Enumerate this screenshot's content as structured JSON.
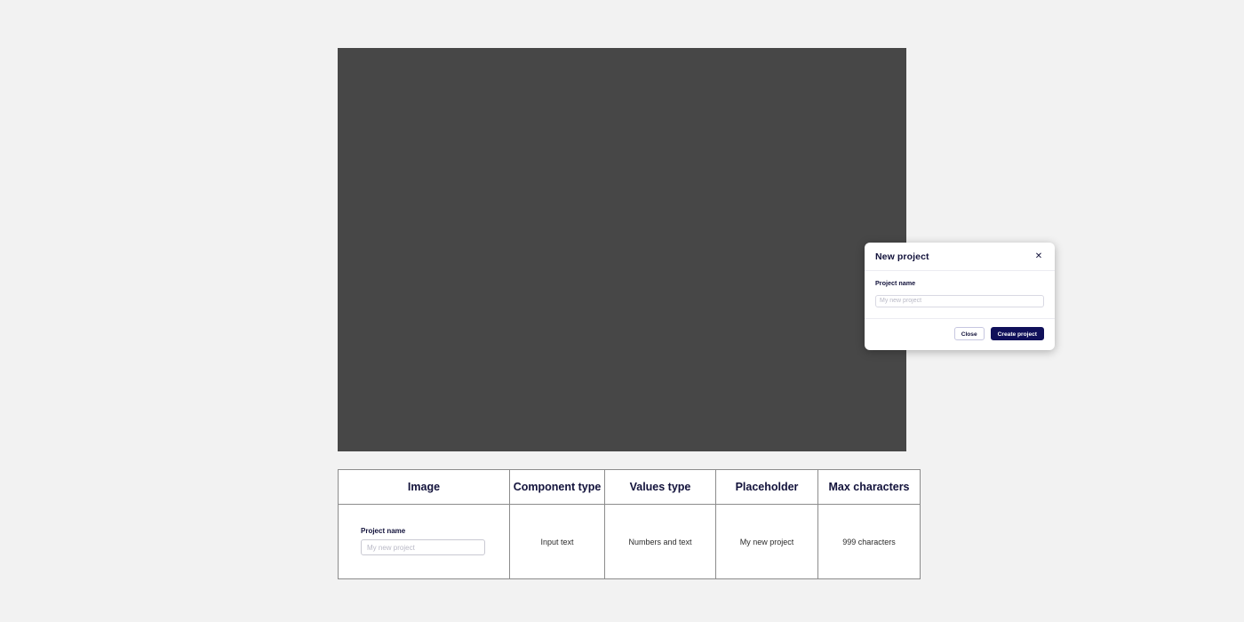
{
  "page": {
    "background_color": "#f2f2f2"
  },
  "preview": {
    "backdrop_color": "#474747"
  },
  "modal": {
    "title": "New project",
    "close_icon": "close-icon",
    "close_glyph": "✕",
    "field": {
      "label": "Project name",
      "value": "",
      "placeholder": "My new project"
    },
    "buttons": {
      "secondary_label": "Close",
      "primary_label": "Create project",
      "primary_color": "#10105a",
      "secondary_border_color": "#c7c7e0"
    }
  },
  "spec_table": {
    "headers": [
      "Image",
      "Component type",
      "Values type",
      "Placeholder",
      "Max characters"
    ],
    "rows": [
      {
        "image": {
          "label": "Project name",
          "value": "",
          "placeholder": "My new project"
        },
        "component_type": "Input text",
        "values_type": "Numbers and text",
        "placeholder": "My new project",
        "max_characters": "999 characters"
      }
    ]
  }
}
